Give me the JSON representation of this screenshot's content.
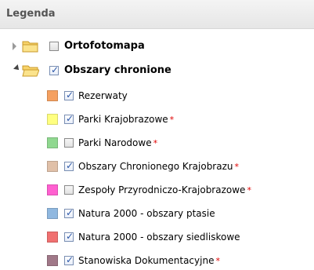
{
  "panel": {
    "title": "Legenda"
  },
  "groups": [
    {
      "label": "Ortofotomapa",
      "expanded": false,
      "checked": false
    },
    {
      "label": "Obszary chronione",
      "expanded": true,
      "checked": true
    }
  ],
  "layers": [
    {
      "label": "Rezerwaty",
      "checked": true,
      "color": "#f5a060",
      "required": ""
    },
    {
      "label": "Parki Krajobrazowe",
      "checked": true,
      "color": "#ffff80",
      "required": "*"
    },
    {
      "label": "Parki Narodowe",
      "checked": false,
      "color": "#90d890",
      "required": "*"
    },
    {
      "label": "Obszary Chronionego Krajobrazu",
      "checked": true,
      "color": "#e0c0a8",
      "required": "*"
    },
    {
      "label": "Zespoły Przyrodniczo-Krajobrazowe",
      "checked": false,
      "color": "#ff60d0",
      "required": "*"
    },
    {
      "label": "Natura 2000 - obszary ptasie",
      "checked": true,
      "color": "#90b8e0",
      "required": ""
    },
    {
      "label": "Natura 2000 - obszary siedliskowe",
      "checked": true,
      "color": "#f07070",
      "required": ""
    },
    {
      "label": "Stanowiska Dokumentacyjne",
      "checked": true,
      "color": "#a07888",
      "required": "*"
    }
  ]
}
